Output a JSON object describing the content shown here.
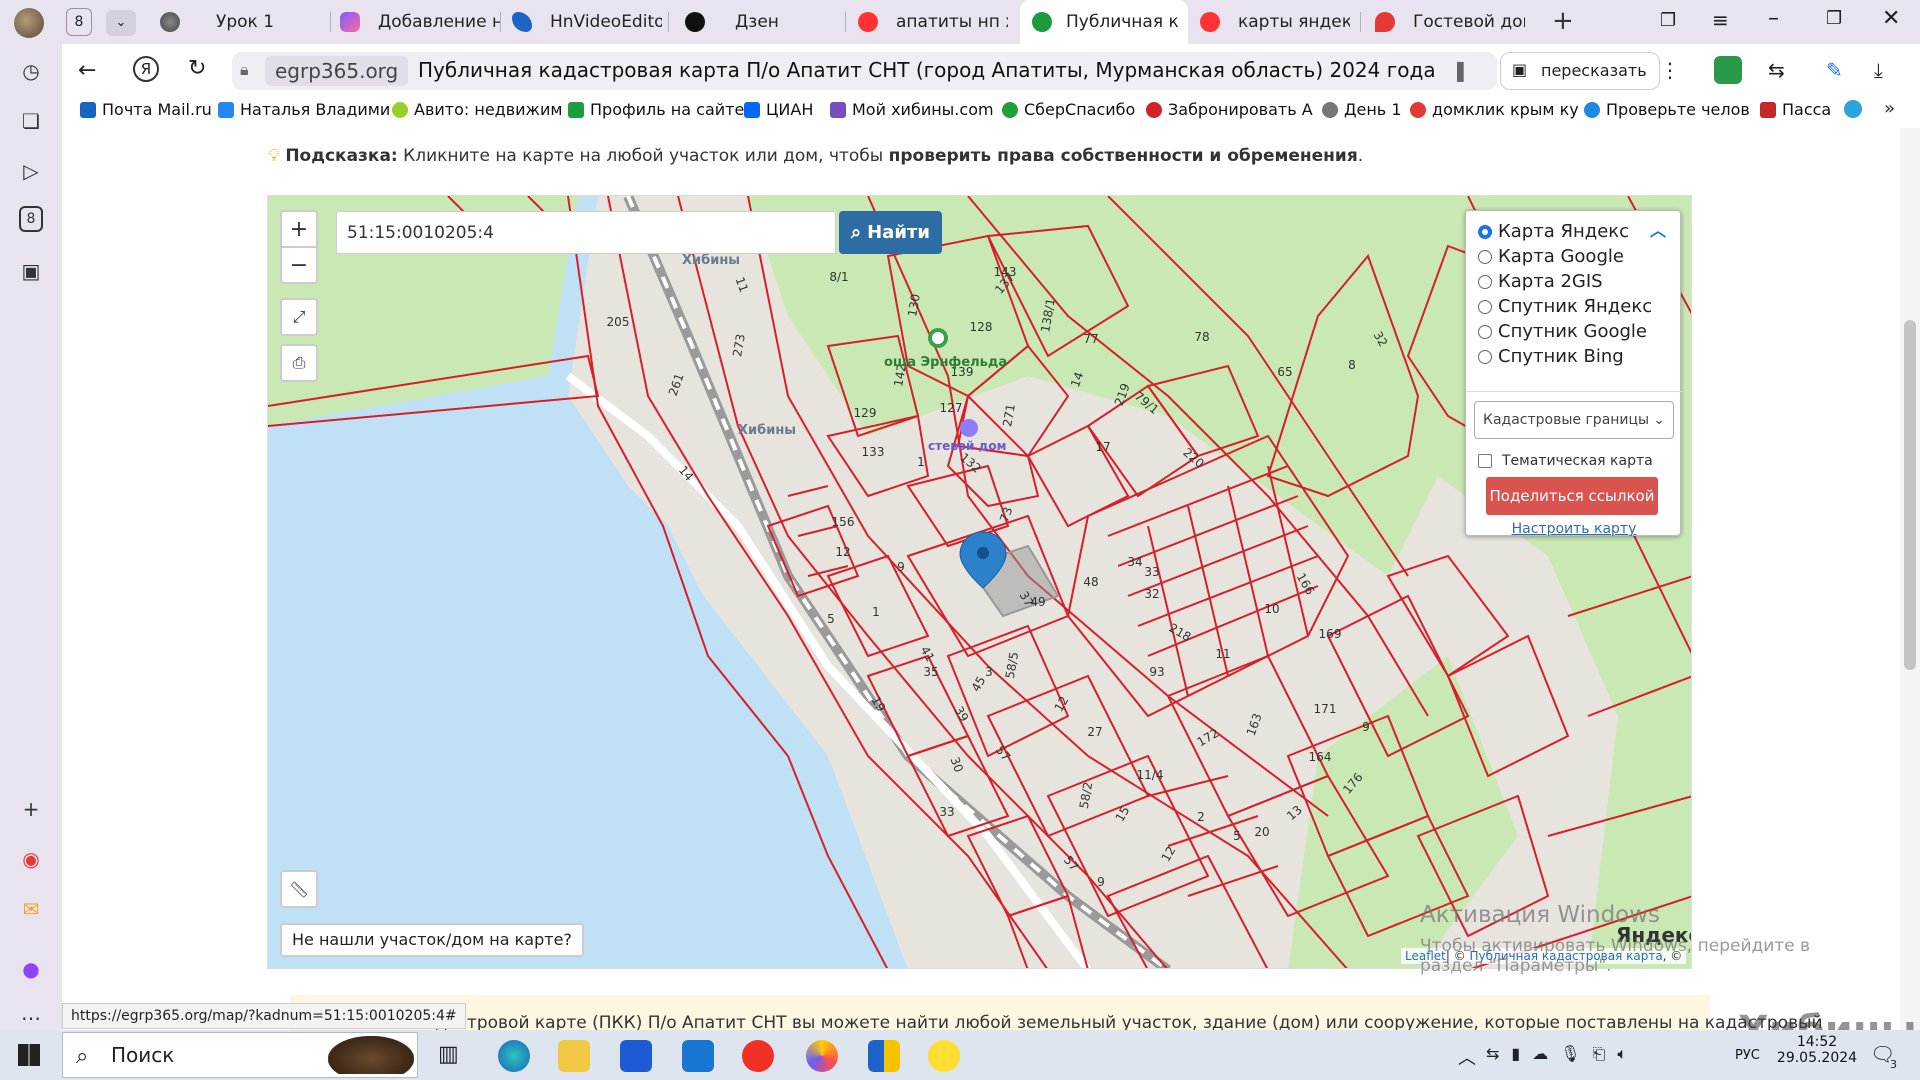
{
  "tabs": [
    {
      "label": "8",
      "kind": "counter"
    },
    {
      "label": "Урок 1"
    },
    {
      "label": "Добавление но"
    },
    {
      "label": "HnVideoEditor_"
    },
    {
      "label": "Дзен"
    },
    {
      "label": "апатиты нп хиб"
    },
    {
      "label": "Публичная к",
      "active": true
    },
    {
      "label": "карты яндекс к"
    },
    {
      "label": "Гостевой дом –"
    }
  ],
  "address": {
    "domain": "egrp365.org",
    "title": "Публичная кадастровая карта П/о Апатит СНТ (город Апатиты, Мурманская область) 2024 года",
    "retell_label": "пересказать"
  },
  "bookmarks": [
    {
      "label": "Почта Mail.ru",
      "color": "#1565c0"
    },
    {
      "label": "Наталья Владими",
      "color": "#2787f5"
    },
    {
      "label": "Авито: недвижим",
      "color": "#97cf26"
    },
    {
      "label": "Профиль на сайте",
      "color": "#1a9e3f"
    },
    {
      "label": "ЦИАН",
      "color": "#0468ff"
    },
    {
      "label": "Мой хибины.com",
      "color": "#7a4cc2"
    },
    {
      "label": "СберСпасибо",
      "color": "#21a038"
    },
    {
      "label": "Забронировать А",
      "color": "#d2232a"
    },
    {
      "label": "День 1",
      "color": "#777777"
    },
    {
      "label": "домклик крым ку",
      "color": "#e53935"
    },
    {
      "label": "Проверьте челов",
      "color": "#1e88e5"
    },
    {
      "label": "Пасса",
      "color": "#c62828"
    }
  ],
  "hint": {
    "prefix": "Подсказка:",
    "text1": " Кликните на карте на любой участок или дом, чтобы ",
    "bold": "проверить права собственности и обременения",
    "text2": "."
  },
  "map": {
    "search_value": "51:15:0010205:4",
    "find_label": "Найти",
    "zoom_in": "+",
    "zoom_out": "−",
    "layers": [
      {
        "label": "Карта Яндекс",
        "selected": true
      },
      {
        "label": "Карта Google",
        "selected": false
      },
      {
        "label": "Карта 2GIS",
        "selected": false
      },
      {
        "label": "Спутник Яндекс",
        "selected": false
      },
      {
        "label": "Спутник Google",
        "selected": false
      },
      {
        "label": "Спутник Bing",
        "selected": false
      }
    ],
    "layer_select": "Кадастровые границы",
    "thematic_label": "Тематическая карта",
    "share_label": "Поделиться ссылкой",
    "tune_label": "Настроить карту",
    "not_found_label": "Не нашли участок/дом на карте?",
    "attribution_leaflet": "Leaflet",
    "attribution_text": "| © ",
    "attribution_pkk": "Публичная кадастровая карта",
    "attribution_tail": ", ©",
    "yandex_logo": "Яндекс",
    "place_labels": [
      "Хибины",
      "Хибины",
      "оща Эрнфельда",
      "стевой дом"
    ],
    "parcel_numbers": [
      "143",
      "130",
      "128",
      "138/1",
      "77",
      "78",
      "65",
      "8",
      "32",
      "142",
      "139",
      "129",
      "127",
      "133",
      "1",
      "132",
      "156",
      "12",
      "219",
      "79/1",
      "220",
      "17",
      "13",
      "73",
      "49",
      "48",
      "34",
      "33",
      "32",
      "218",
      "93",
      "10",
      "166",
      "169",
      "11",
      "171",
      "9",
      "163",
      "172",
      "164",
      "176",
      "13",
      "20",
      "11/4",
      "58/5",
      "58/2",
      "45",
      "57",
      "30",
      "33",
      "15",
      "12",
      "27",
      "5",
      "9",
      "3",
      "271",
      "273",
      "261",
      "14",
      "11",
      "2",
      "3",
      "5",
      "2",
      "1",
      "41",
      "39",
      "37",
      "57",
      "35"
    ]
  },
  "windows_activation": {
    "title": "Активация Windows",
    "subtitle": "Чтобы активировать Windows, перейдите в раздел \"Параметры\"."
  },
  "status_url": "https://egrp365.org/map/?kadnum=51:15:0010205:4#",
  "bottom_text": "адастровой карте (ПКК) П/о Апатит СНТ вы можете найти любой земельный участок, здание (дом) или сооружение, которые поставлены на кадастровый",
  "watermark": "Хибины",
  "taskbar": {
    "search_label": "Поиск",
    "lang": "РУС",
    "time": "14:52",
    "date": "29.05.2024",
    "notifications": "3"
  }
}
